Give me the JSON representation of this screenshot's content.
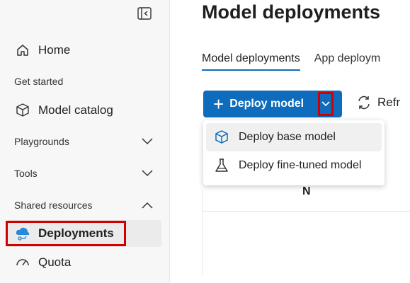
{
  "sidebar": {
    "collapse_icon": "panel-collapse-icon",
    "items": [
      {
        "label": "Home",
        "icon": "home-icon"
      },
      {
        "label": "Model catalog",
        "icon": "cube-stack-icon"
      },
      {
        "label": "Deployments",
        "icon": "cloud-deploy-icon",
        "selected": true
      },
      {
        "label": "Quota",
        "icon": "gauge-icon"
      }
    ],
    "sections": [
      {
        "label": "Get started"
      },
      {
        "label": "Playgrounds",
        "expanded": false
      },
      {
        "label": "Tools",
        "expanded": false
      },
      {
        "label": "Shared resources",
        "expanded": true
      }
    ]
  },
  "main": {
    "title": "Model deployments",
    "tabs": [
      {
        "label": "Model deployments",
        "active": true
      },
      {
        "label": "App deploym",
        "active": false
      }
    ],
    "toolbar": {
      "deploy_label": "Deploy model",
      "refresh_label": "Refr"
    },
    "dropdown": {
      "items": [
        {
          "label": "Deploy base model",
          "icon": "cube-icon"
        },
        {
          "label": "Deploy fine-tuned model",
          "icon": "flask-icon"
        }
      ]
    },
    "table_header_fragment": "N"
  },
  "colors": {
    "accent": "#0f6cbd",
    "highlight": "#d00000",
    "sidebar_bg": "#f7f7f7"
  }
}
